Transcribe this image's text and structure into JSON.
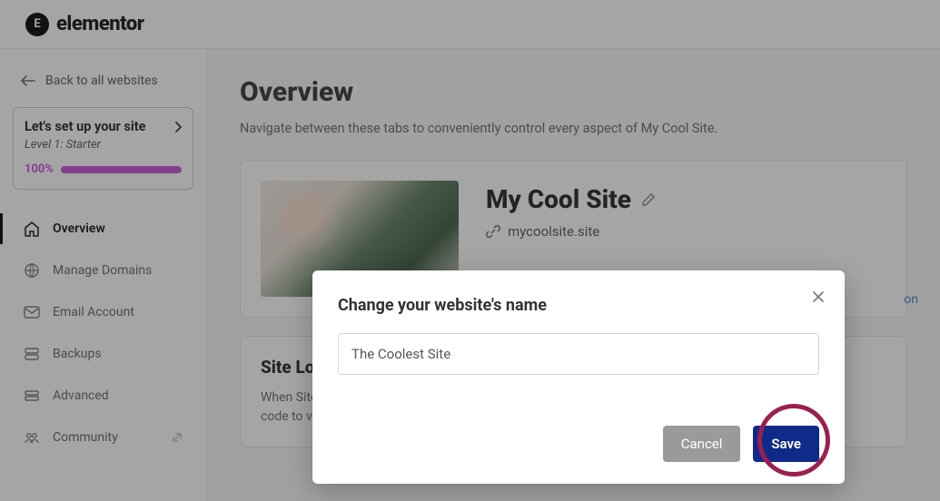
{
  "brand": {
    "mark": "E",
    "name": "elementor"
  },
  "sidebar": {
    "back_label": "Back to all websites",
    "setup": {
      "title": "Let's set up your site",
      "level": "Level 1: Starter",
      "percent": "100%"
    },
    "items": [
      {
        "label": "Overview"
      },
      {
        "label": "Manage Domains"
      },
      {
        "label": "Email Account"
      },
      {
        "label": "Backups"
      },
      {
        "label": "Advanced"
      },
      {
        "label": "Community"
      }
    ]
  },
  "page": {
    "title": "Overview",
    "subtitle": "Navigate between these tabs to conveniently control every aspect of My Cool Site."
  },
  "site": {
    "name": "My Cool Site",
    "domain": "mycoolsite.site",
    "link_fragment": "on"
  },
  "lock_card": {
    "title_fragment": "Site Loc",
    "body_line1_fragment": "When Site",
    "body_line2_fragment": "code to vie"
  },
  "modal": {
    "title": "Change your website's name",
    "input_value": "The Coolest Site",
    "cancel": "Cancel",
    "save": "Save"
  }
}
